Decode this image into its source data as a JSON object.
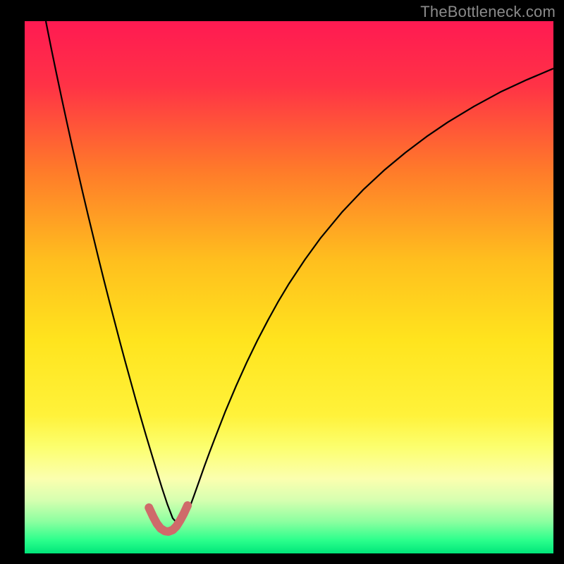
{
  "watermark": "TheBottleneck.com",
  "chart_data": {
    "type": "line",
    "title": "",
    "xlabel": "",
    "ylabel": "",
    "xlim": [
      0,
      100
    ],
    "ylim": [
      0,
      100
    ],
    "background_gradient_stops": [
      {
        "offset": 0.0,
        "color": "#ff1a52"
      },
      {
        "offset": 0.12,
        "color": "#ff3246"
      },
      {
        "offset": 0.28,
        "color": "#ff7a2a"
      },
      {
        "offset": 0.45,
        "color": "#ffbf1e"
      },
      {
        "offset": 0.6,
        "color": "#ffe41e"
      },
      {
        "offset": 0.74,
        "color": "#fff23a"
      },
      {
        "offset": 0.8,
        "color": "#fcff6e"
      },
      {
        "offset": 0.86,
        "color": "#fbffaf"
      },
      {
        "offset": 0.9,
        "color": "#d6ffb0"
      },
      {
        "offset": 0.94,
        "color": "#8cffa0"
      },
      {
        "offset": 0.975,
        "color": "#2cff8c"
      },
      {
        "offset": 1.0,
        "color": "#00e67a"
      }
    ],
    "curve_minimum": {
      "x": 27,
      "y": 4
    },
    "series": [
      {
        "name": "curve",
        "color": "#000000",
        "stroke_width": 2.2,
        "x": [
          4,
          5,
          6,
          7,
          8,
          9,
          10,
          11,
          12,
          13,
          14,
          15,
          16,
          17,
          18,
          19,
          20,
          21,
          22,
          23,
          24,
          25,
          26,
          27,
          28,
          29,
          30,
          31,
          32,
          33,
          34,
          35,
          36,
          38,
          40,
          42,
          44,
          46,
          48,
          50,
          53,
          56,
          60,
          64,
          68,
          72,
          76,
          80,
          85,
          90,
          95,
          100
        ],
        "y": [
          100,
          95,
          90.2,
          85.5,
          80.9,
          76.4,
          72,
          67.7,
          63.5,
          59.4,
          55.3,
          51.3,
          47.4,
          43.6,
          39.8,
          36.1,
          32.5,
          28.9,
          25.4,
          22,
          18.7,
          15.4,
          12.2,
          9.2,
          6.6,
          5.5,
          6,
          8.1,
          10.8,
          13.6,
          16.4,
          19.1,
          21.7,
          26.8,
          31.5,
          35.9,
          40,
          43.8,
          47.4,
          50.7,
          55.2,
          59.3,
          64.1,
          68.3,
          72,
          75.3,
          78.3,
          81,
          84,
          86.7,
          89,
          91.1
        ]
      },
      {
        "name": "highlight",
        "color": "#cf6a6a",
        "stroke_width": 12,
        "linecap": "round",
        "x": [
          23.5,
          24.3,
          25,
          25.7,
          26.5,
          27.2,
          28,
          28.7,
          29.4,
          30.1,
          30.8
        ],
        "y": [
          8.6,
          6.9,
          5.6,
          4.7,
          4.2,
          4.1,
          4.4,
          5.1,
          6.2,
          7.5,
          9.0
        ]
      }
    ]
  }
}
